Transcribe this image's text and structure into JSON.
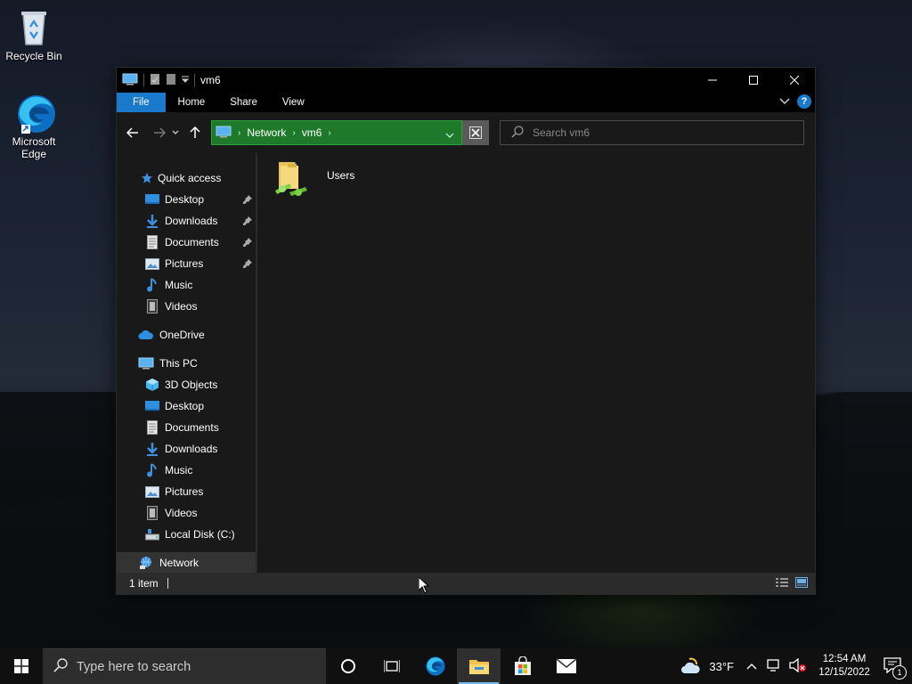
{
  "desktop": {
    "icons": [
      {
        "label": "Recycle Bin"
      },
      {
        "label": "Microsoft Edge"
      }
    ]
  },
  "window": {
    "title": "vm6",
    "controls": {
      "minimize": "—",
      "maximize": "☐",
      "close": "✕"
    },
    "ribbon": {
      "tabs": [
        "File",
        "Home",
        "Share",
        "View"
      ],
      "help": "?"
    },
    "address": {
      "crumbs": [
        "Network",
        "vm6"
      ]
    },
    "search": {
      "placeholder": "Search vm6"
    },
    "sidebar": {
      "quick_access": "Quick access",
      "quick_items": [
        "Desktop",
        "Downloads",
        "Documents",
        "Pictures",
        "Music",
        "Videos"
      ],
      "onedrive": "OneDrive",
      "this_pc": "This PC",
      "pc_items": [
        "3D Objects",
        "Desktop",
        "Documents",
        "Downloads",
        "Music",
        "Pictures",
        "Videos",
        "Local Disk (C:)"
      ],
      "network": "Network"
    },
    "content": {
      "items": [
        {
          "name": "Users"
        }
      ]
    },
    "status": {
      "count": "1 item"
    }
  },
  "taskbar": {
    "search_placeholder": "Type here to search",
    "weather": "33°F",
    "time": "12:54 AM",
    "date": "12/15/2022",
    "notifications": "1"
  },
  "colors": {
    "accent": "#1979ca",
    "address_bg": "#1e7a2a",
    "window_bg": "#191919"
  }
}
